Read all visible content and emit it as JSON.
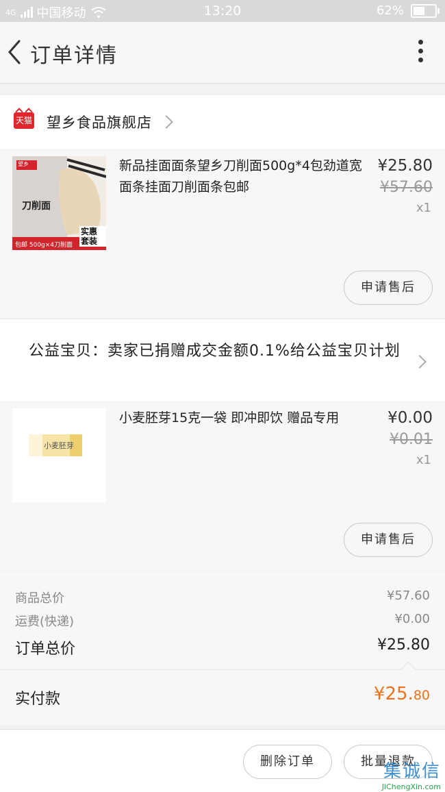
{
  "status_bar": {
    "network": "4G",
    "carrier": "中国移动",
    "time": "13:20",
    "battery_text": "62%",
    "battery_level": 0.62
  },
  "header": {
    "title": "订单详情",
    "back_icon": "chevron-left-icon",
    "more_icon": "more-vertical-icon"
  },
  "shop": {
    "badge": "天猫",
    "name": "望乡食品旗舰店"
  },
  "items": [
    {
      "title": "新品挂面面条望乡刀削面500g*4包劲道宽面条挂面刀削面条包邮",
      "price": "¥25.80",
      "original_price": "¥57.60",
      "quantity": "x1",
      "after_sale_label": "申请售后",
      "thumb": {
        "brand": "望乡",
        "name": "刀削面",
        "tag": "实惠套装",
        "strip": "包邮  500g×4刀削面"
      }
    },
    {
      "title": "小麦胚芽15克一袋 即冲即饮 赠品专用",
      "price": "¥0.00",
      "original_price": "¥0.01",
      "quantity": "x1",
      "after_sale_label": "申请售后",
      "thumb": {
        "name": "小麦胚芽"
      }
    }
  ],
  "charity": {
    "text": "公益宝贝：卖家已捐赠成交金额0.1%给公益宝贝计划"
  },
  "summary": {
    "goods_total_label": "商品总价",
    "goods_total_value": "¥57.60",
    "shipping_label": "运费(快递)",
    "shipping_value": "¥0.00",
    "order_total_label": "订单总价",
    "order_total_value": "¥25.80"
  },
  "paid": {
    "label": "实付款",
    "value_main": "¥25.",
    "value_cents": "80",
    "accent_color": "#f0701a"
  },
  "actions": {
    "delete_label": "删除订单",
    "batch_refund_label": "批量退款"
  },
  "watermark": {
    "text": "集诚信",
    "url": "JiChengXin.com"
  }
}
